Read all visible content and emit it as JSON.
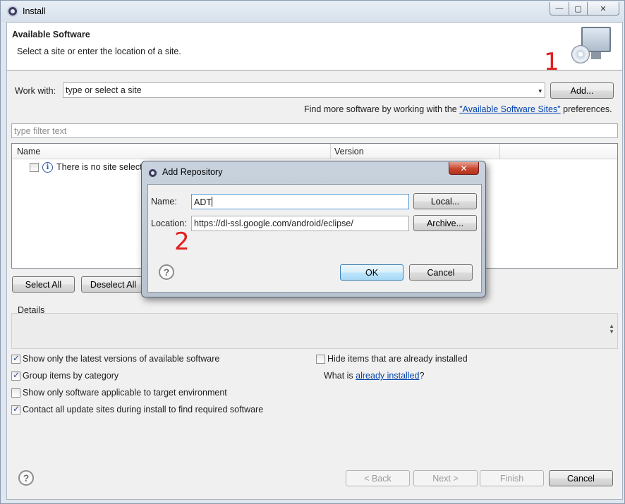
{
  "window": {
    "title": "Install",
    "min_label": "—",
    "max_label": "▢",
    "close_label": "✕"
  },
  "banner": {
    "title": "Available Software",
    "subtitle": "Select a site or enter the location of a site."
  },
  "work_with": {
    "label": "Work with:",
    "placeholder": "type or select a site",
    "add_label": "Add...",
    "find_more_prefix": "Find more software by working with the ",
    "find_more_link": "\"Available Software Sites\"",
    "find_more_suffix": " preferences."
  },
  "filter": {
    "placeholder": "type filter text"
  },
  "table": {
    "columns": [
      "Name",
      "Version"
    ],
    "empty_row": "There is no site selecte"
  },
  "selection": {
    "select_all": "Select All",
    "deselect_all": "Deselect All"
  },
  "details": {
    "label": "Details"
  },
  "options": {
    "latest": {
      "label": "Show only the latest versions of available software",
      "checked": true
    },
    "group": {
      "label": "Group items by category",
      "checked": true
    },
    "target": {
      "label": "Show only software applicable to target environment",
      "checked": false
    },
    "contact": {
      "label": "Contact all update sites during install to find required software",
      "checked": true
    },
    "hide": {
      "label": "Hide items that are already installed",
      "checked": false
    },
    "what_is_prefix": "What is ",
    "what_is_link": "already installed",
    "what_is_suffix": "?"
  },
  "footer": {
    "back": "< Back",
    "next": "Next >",
    "finish": "Finish",
    "cancel": "Cancel"
  },
  "dialog": {
    "title": "Add Repository",
    "name_label": "Name:",
    "name_value": "ADT",
    "location_label": "Location:",
    "location_value": "https://dl-ssl.google.com/android/eclipse/",
    "local_label": "Local...",
    "archive_label": "Archive...",
    "ok_label": "OK",
    "cancel_label": "Cancel",
    "close_label": "✕"
  },
  "annotations": {
    "step1": "1",
    "step2": "2"
  },
  "icons": {
    "help": "?",
    "info": "i",
    "combo_arrow": "▾"
  },
  "colors": {
    "annotation": "#e02020",
    "link": "#0645ad"
  }
}
